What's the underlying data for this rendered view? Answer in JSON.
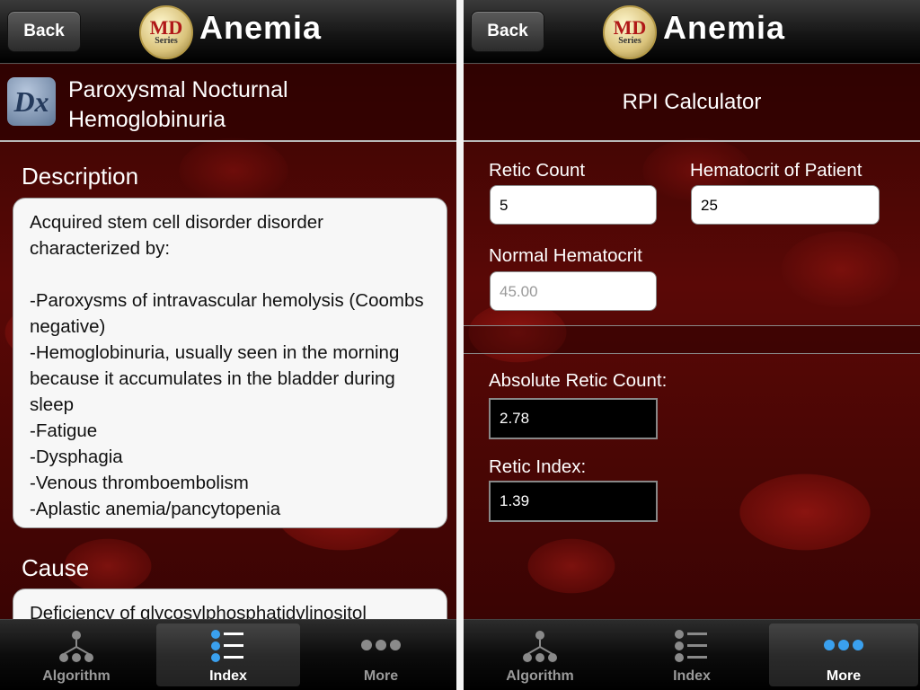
{
  "left": {
    "back_label": "Back",
    "logo_text": "MD",
    "logo_sub": "Series",
    "title": "Anemia",
    "dx_icon": "Dx",
    "dx_title_line1": "Paroxysmal Nocturnal",
    "dx_title_line2": "Hemoglobinuria",
    "description_heading": "Description",
    "description_text": "Acquired stem cell disorder disorder characterized by:\n\n-Paroxysms of intravascular hemolysis (Coombs negative)\n-Hemoglobinuria, usually seen in the morning because it accumulates in the bladder during sleep\n-Fatigue\n-Dysphagia\n-Venous thromboembolism\n-Aplastic anemia/pancytopenia",
    "cause_heading": "Cause",
    "cause_text": "Deficiency of glycosylphosphatidylinositol",
    "tabs": [
      {
        "label": "Algorithm",
        "icon": "tree-icon",
        "active": false
      },
      {
        "label": "Index",
        "icon": "list-icon",
        "active": true
      },
      {
        "label": "More",
        "icon": "more-dots-icon",
        "active": false
      }
    ]
  },
  "right": {
    "back_label": "Back",
    "logo_text": "MD",
    "logo_sub": "Series",
    "title": "Anemia",
    "calc_title": "RPI Calculator",
    "retic_count_label": "Retic Count",
    "retic_count_value": "5",
    "hematocrit_label": "Hematocrit of Patient",
    "hematocrit_value": "25",
    "normal_hct_label": "Normal Hematocrit",
    "normal_hct_placeholder": "45.00",
    "abs_retic_label": "Absolute Retic Count:",
    "abs_retic_value": "2.78",
    "retic_index_label": "Retic Index:",
    "retic_index_value": "1.39",
    "tabs": [
      {
        "label": "Algorithm",
        "icon": "tree-icon",
        "active": false
      },
      {
        "label": "Index",
        "icon": "list-icon",
        "active": false
      },
      {
        "label": "More",
        "icon": "more-dots-icon",
        "active": true
      }
    ]
  },
  "colors": {
    "accent_blue": "#3aa0ee",
    "text_white": "#ffffff",
    "bg_red": "#5a0806"
  }
}
